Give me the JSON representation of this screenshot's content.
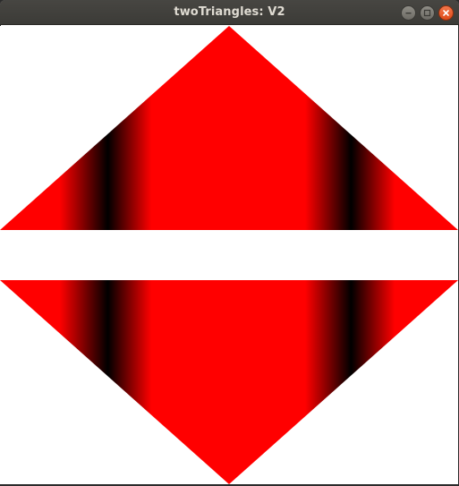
{
  "window": {
    "title": "twoTriangles: V2"
  },
  "controls": {
    "minimize_icon": "minimize-icon",
    "maximize_icon": "maximize-icon",
    "close_icon": "close-icon"
  },
  "canvas": {
    "shape_color": "#ff0000",
    "band_color": "#000000",
    "background": "#ffffff"
  }
}
